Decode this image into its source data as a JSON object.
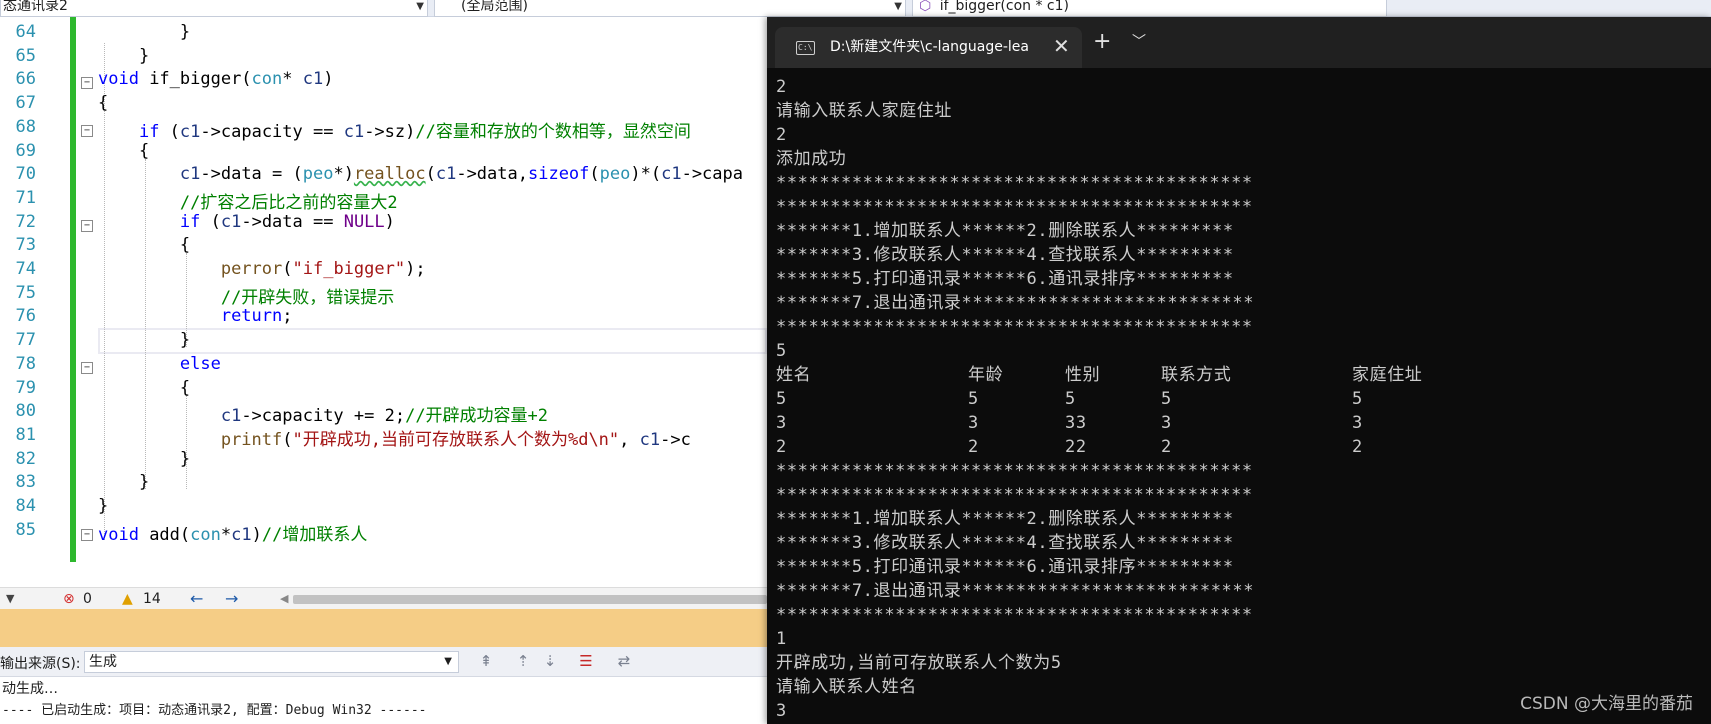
{
  "navbar": {
    "project": "态通讯录2",
    "scope": "(全局范围)",
    "member": "if_bigger(con * c1)"
  },
  "editor": {
    "lines": [
      {
        "n": "64",
        "code": "        }"
      },
      {
        "n": "65",
        "code": "    }"
      },
      {
        "n": "66",
        "code": "void if_bigger(con* c1)"
      },
      {
        "n": "67",
        "code": "{"
      },
      {
        "n": "68",
        "code": "    if (c1->capacity == c1->sz)//容量和存放的个数相等，显然空间"
      },
      {
        "n": "69",
        "code": "    {"
      },
      {
        "n": "70",
        "code": "        c1->data = (peo*)realloc(c1->data,sizeof(peo)*(c1->capa"
      },
      {
        "n": "71",
        "code": "        //扩容之后比之前的容量大2"
      },
      {
        "n": "72",
        "code": "        if (c1->data == NULL)"
      },
      {
        "n": "73",
        "code": "        {"
      },
      {
        "n": "74",
        "code": "            perror(\"if_bigger\");"
      },
      {
        "n": "75",
        "code": "            //开辟失败，错误提示"
      },
      {
        "n": "76",
        "code": "            return;"
      },
      {
        "n": "77",
        "code": "        }"
      },
      {
        "n": "78",
        "code": "        else"
      },
      {
        "n": "79",
        "code": "        {"
      },
      {
        "n": "80",
        "code": "            c1->capacity += 2;//开辟成功容量+2"
      },
      {
        "n": "81",
        "code": "            printf(\"开辟成功,当前可存放联系人个数为%d\\n\", c1->c"
      },
      {
        "n": "82",
        "code": "        }"
      },
      {
        "n": "83",
        "code": "    }"
      },
      {
        "n": "84",
        "code": "}"
      },
      {
        "n": "85",
        "code": "void add(con*c1)//增加联系人"
      }
    ]
  },
  "statusbar": {
    "errors": "0",
    "warnings": "14"
  },
  "output": {
    "source_label": "输出来源(S):",
    "source_value": "生成",
    "line1": "动生成…",
    "line2": "---- 已启动生成：项目：动态通讯录2, 配置：Debug Win32 ------"
  },
  "terminal": {
    "tab_title": "D:\\新建文件夹\\c-language-lea",
    "lines": [
      "2",
      "请输入联系人家庭住址",
      "2",
      "添加成功",
      "********************************************",
      "********************************************",
      "*******1.增加联系人******2.删除联系人*********",
      "*******3.修改联系人******4.查找联系人*********",
      "*******5.打印通讯录******6.通讯录排序*********",
      "*******7.退出通讯录***************************",
      "********************************************",
      "5",
      "",
      "",
      "",
      "",
      "********************************************",
      "********************************************",
      "*******1.增加联系人******2.删除联系人*********",
      "*******3.修改联系人******4.查找联系人*********",
      "*******5.打印通讯录******6.通讯录排序*********",
      "*******7.退出通讯录***************************",
      "********************************************",
      "1",
      "开辟成功,当前可存放联系人个数为5",
      "请输入联系人姓名",
      "3"
    ],
    "table": {
      "headers": [
        "姓名",
        "年龄",
        "性别",
        "联系方式",
        "家庭住址"
      ],
      "rows": [
        [
          "5",
          "5",
          "5",
          "5",
          "5"
        ],
        [
          "3",
          "3",
          "33",
          "3",
          "3"
        ],
        [
          "2",
          "2",
          "22",
          "2",
          "2"
        ]
      ]
    }
  },
  "watermark": "CSDN @大海里的番茄"
}
